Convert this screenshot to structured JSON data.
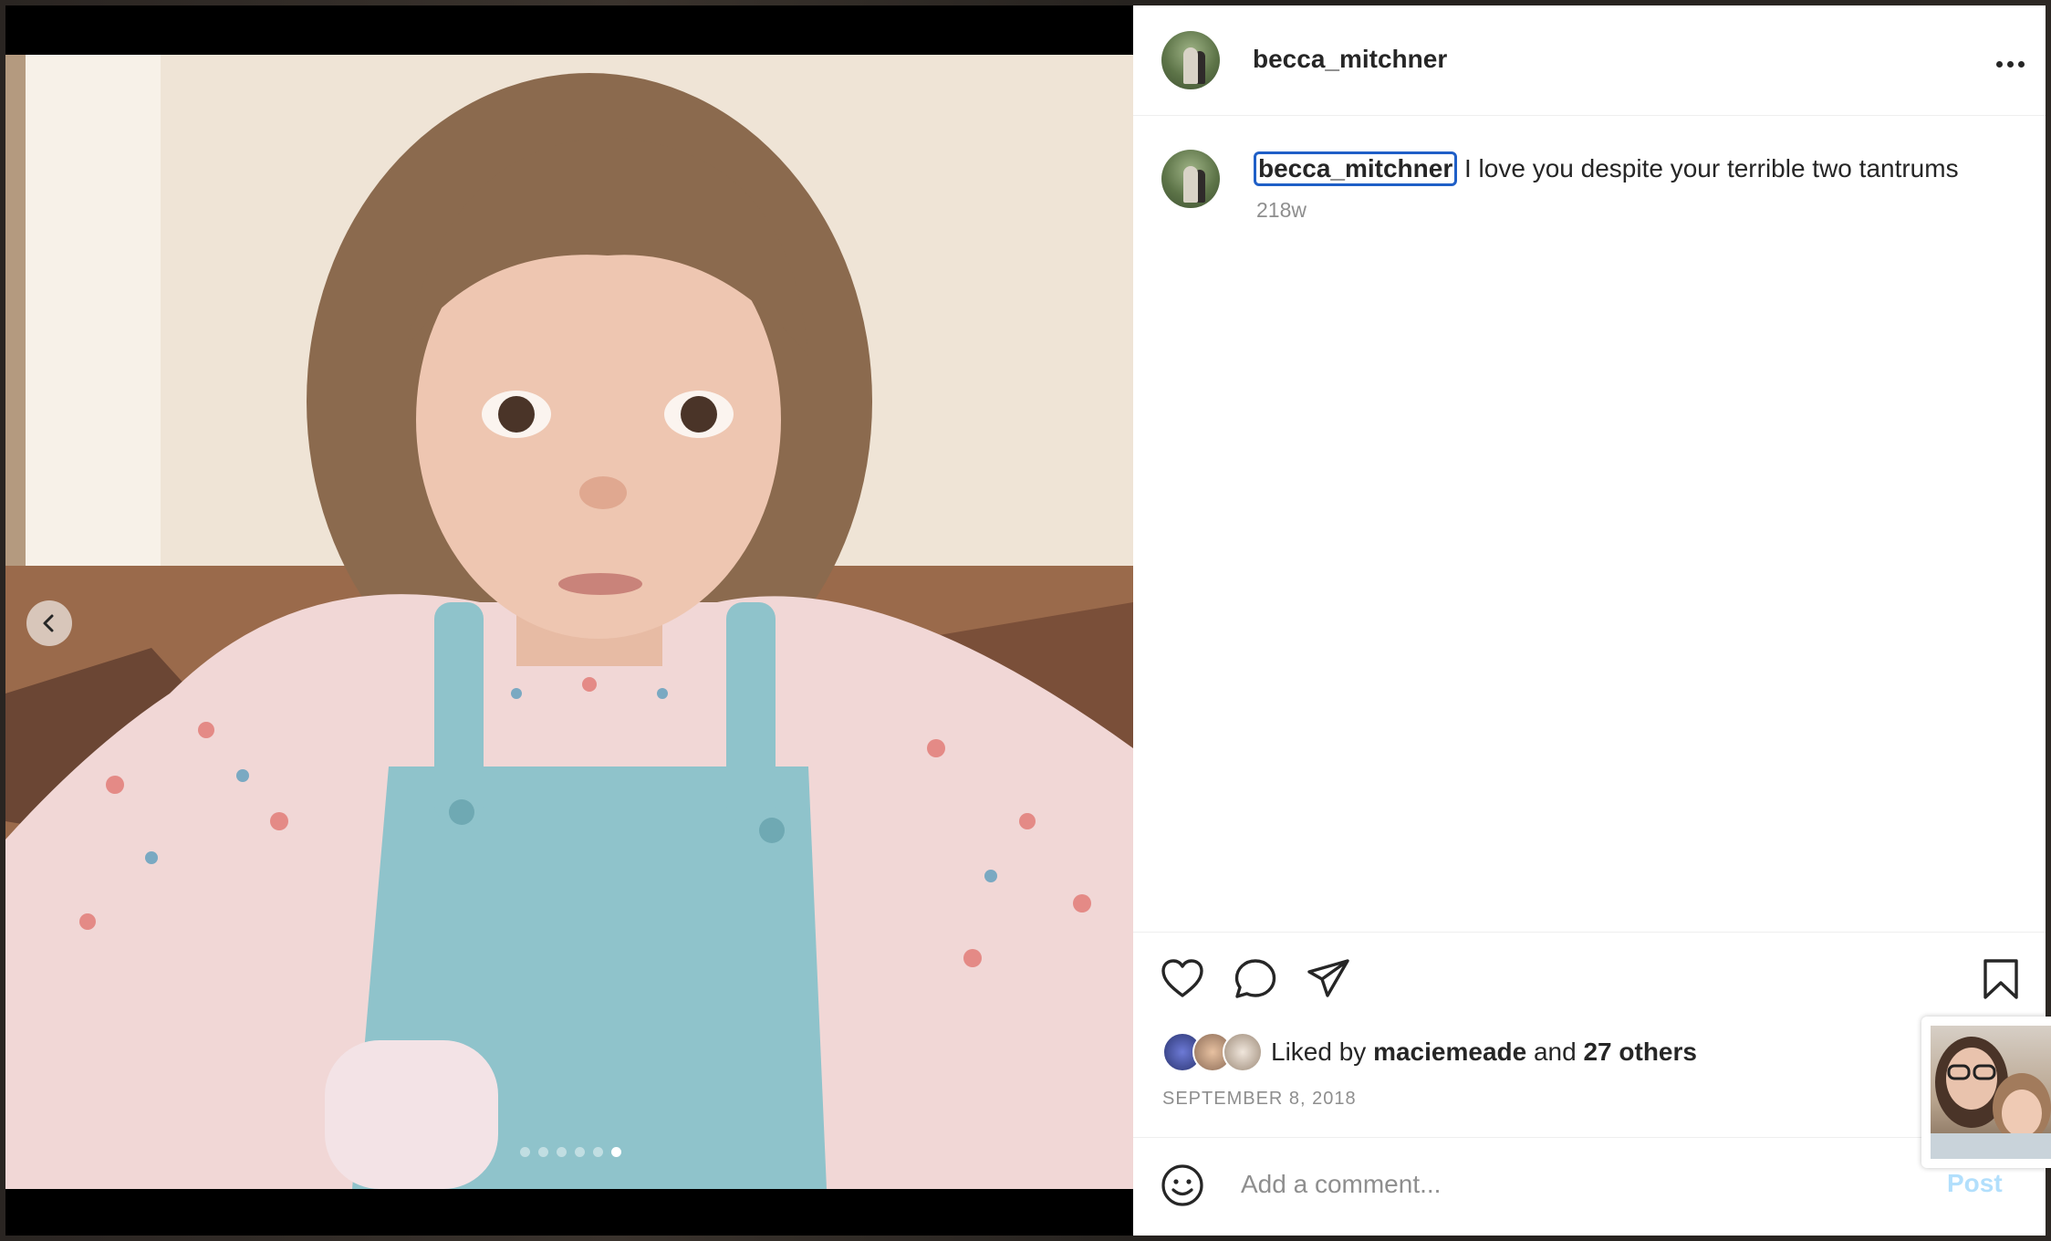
{
  "post": {
    "author": "becca_mitchner",
    "caption_user": "becca_mitchner",
    "caption_text": " I love you despite your terrible two tantrums",
    "time_ago": "218w",
    "likes_prefix": "Liked by ",
    "likes_user": "maciemeade",
    "likes_and": " and ",
    "likes_others": "27 others",
    "date": "SEPTEMBER 8, 2018"
  },
  "carousel": {
    "slide_count": 6,
    "active_index": 5
  },
  "comment": {
    "placeholder": "Add a comment...",
    "post_label": "Post"
  },
  "icons": {
    "header": [
      "more-options-icon"
    ],
    "actions": [
      "heart-icon",
      "comment-icon",
      "share-icon",
      "bookmark-icon"
    ],
    "media": [
      "chevron-left-icon"
    ],
    "composer": [
      "emoji-icon"
    ]
  },
  "colors": {
    "link_blue": "#1f5fc7",
    "post_disabled": "#b2dffc",
    "muted": "#8e8e8e",
    "text": "#262626"
  }
}
